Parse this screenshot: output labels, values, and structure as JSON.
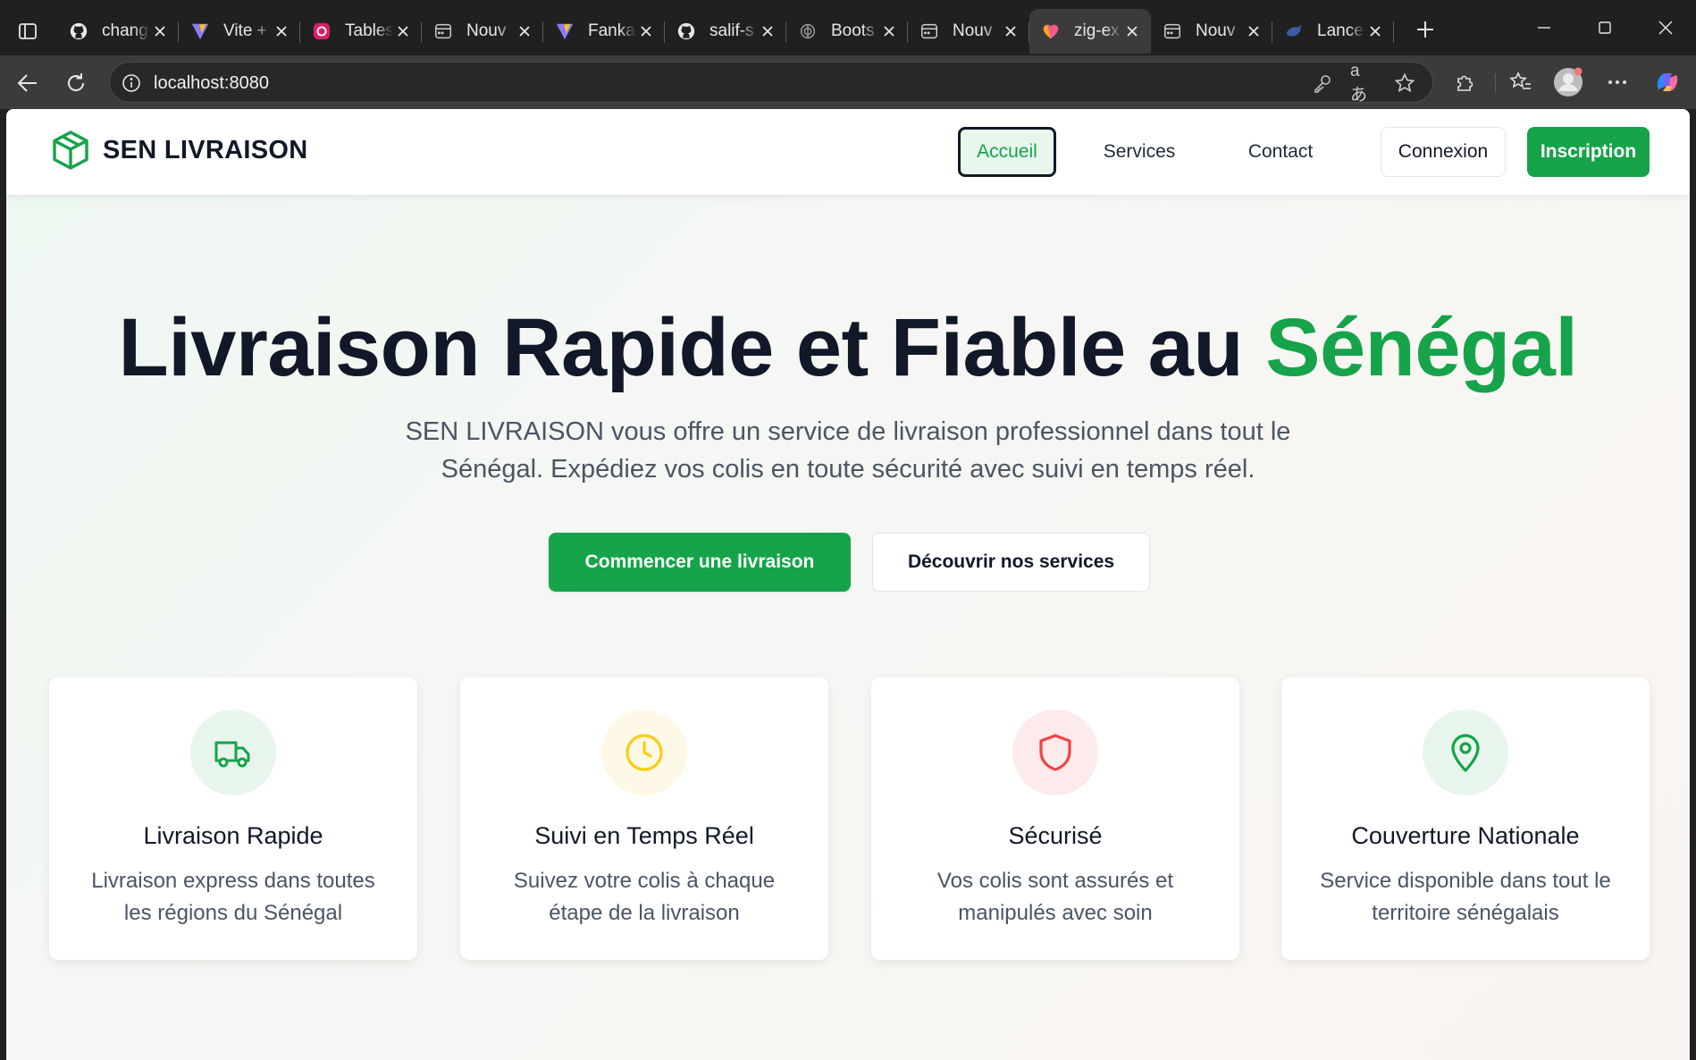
{
  "browser": {
    "tabs": [
      {
        "title": "chang",
        "icon": "github-icon"
      },
      {
        "title": "Vite +",
        "icon": "vite-icon"
      },
      {
        "title": "Tables",
        "icon": "app-icon"
      },
      {
        "title": "Nouv",
        "icon": "page-icon"
      },
      {
        "title": "Fanka",
        "icon": "vite-icon"
      },
      {
        "title": "salif-s",
        "icon": "github-icon"
      },
      {
        "title": "Boots",
        "icon": "openai-icon"
      },
      {
        "title": "Nouv",
        "icon": "page-icon"
      },
      {
        "title": "zig-ex",
        "icon": "heart-icon",
        "active": true
      },
      {
        "title": "Nouv",
        "icon": "page-icon"
      },
      {
        "title": "Lance",
        "icon": "bird-icon"
      }
    ],
    "url": "localhost:8080",
    "translate_glyph": "aあ"
  },
  "site": {
    "brand": "SEN LIVRAISON",
    "nav": {
      "home": "Accueil",
      "services": "Services",
      "contact": "Contact",
      "login": "Connexion",
      "signup": "Inscription"
    },
    "colors": {
      "accent": "#16a34a",
      "dark": "#111827"
    }
  },
  "hero": {
    "title_main": "Livraison Rapide et Fiable au ",
    "title_accent": "Sénégal",
    "subtitle": "SEN LIVRAISON vous offre un service de livraison professionnel dans tout le Sénégal. Expédiez vos colis en toute sécurité avec suivi en temps réel.",
    "cta_primary": "Commencer une livraison",
    "cta_secondary": "Découvrir nos services"
  },
  "features": [
    {
      "title": "Livraison Rapide",
      "text": "Livraison express dans toutes les régions du Sénégal",
      "icon": "truck-icon",
      "color": "#16a34a"
    },
    {
      "title": "Suivi en Temps Réel",
      "text": "Suivez votre colis à chaque étape de la livraison",
      "icon": "clock-icon",
      "color": "#facc15"
    },
    {
      "title": "Sécurisé",
      "text": "Vos colis sont assurés et manipulés avec soin",
      "icon": "shield-icon",
      "color": "#ef4444"
    },
    {
      "title": "Couverture Nationale",
      "text": "Service disponible dans tout le territoire sénégalais",
      "icon": "map-pin-icon",
      "color": "#16a34a"
    }
  ]
}
